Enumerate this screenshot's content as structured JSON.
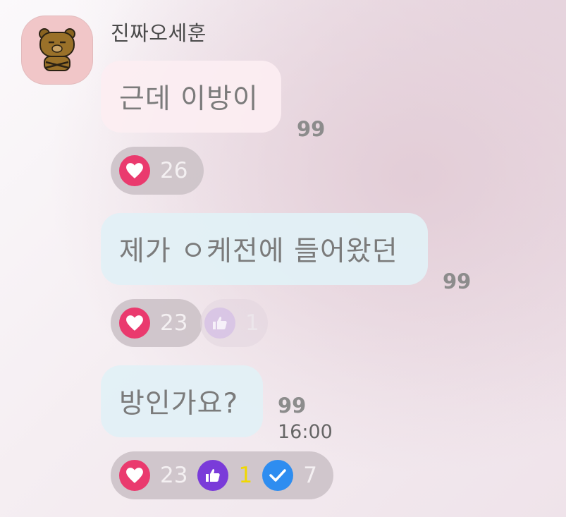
{
  "sender": {
    "name": "진짜오세훈"
  },
  "messages": [
    {
      "text": "근데 이방이",
      "read_count": "99",
      "reactions": {
        "heart": "26"
      }
    },
    {
      "text": "제가 ㅇ케전에 들어왔던",
      "read_count": "99",
      "reactions": {
        "heart": "23",
        "like": "1"
      }
    },
    {
      "text": "방인가요?",
      "read_count": "99",
      "time": "16:00",
      "reactions": {
        "heart": "23",
        "like": "1",
        "check": "7"
      }
    }
  ],
  "colors": {
    "heart": "#ea3a6e",
    "like": "#7a3bd9",
    "check": "#2e8df0",
    "pink_bubble": "#fceef2",
    "blue_bubble": "#e2f0f5"
  },
  "icons": [
    "ryan-avatar",
    "heart-icon",
    "thumbs-up-icon",
    "check-icon"
  ]
}
